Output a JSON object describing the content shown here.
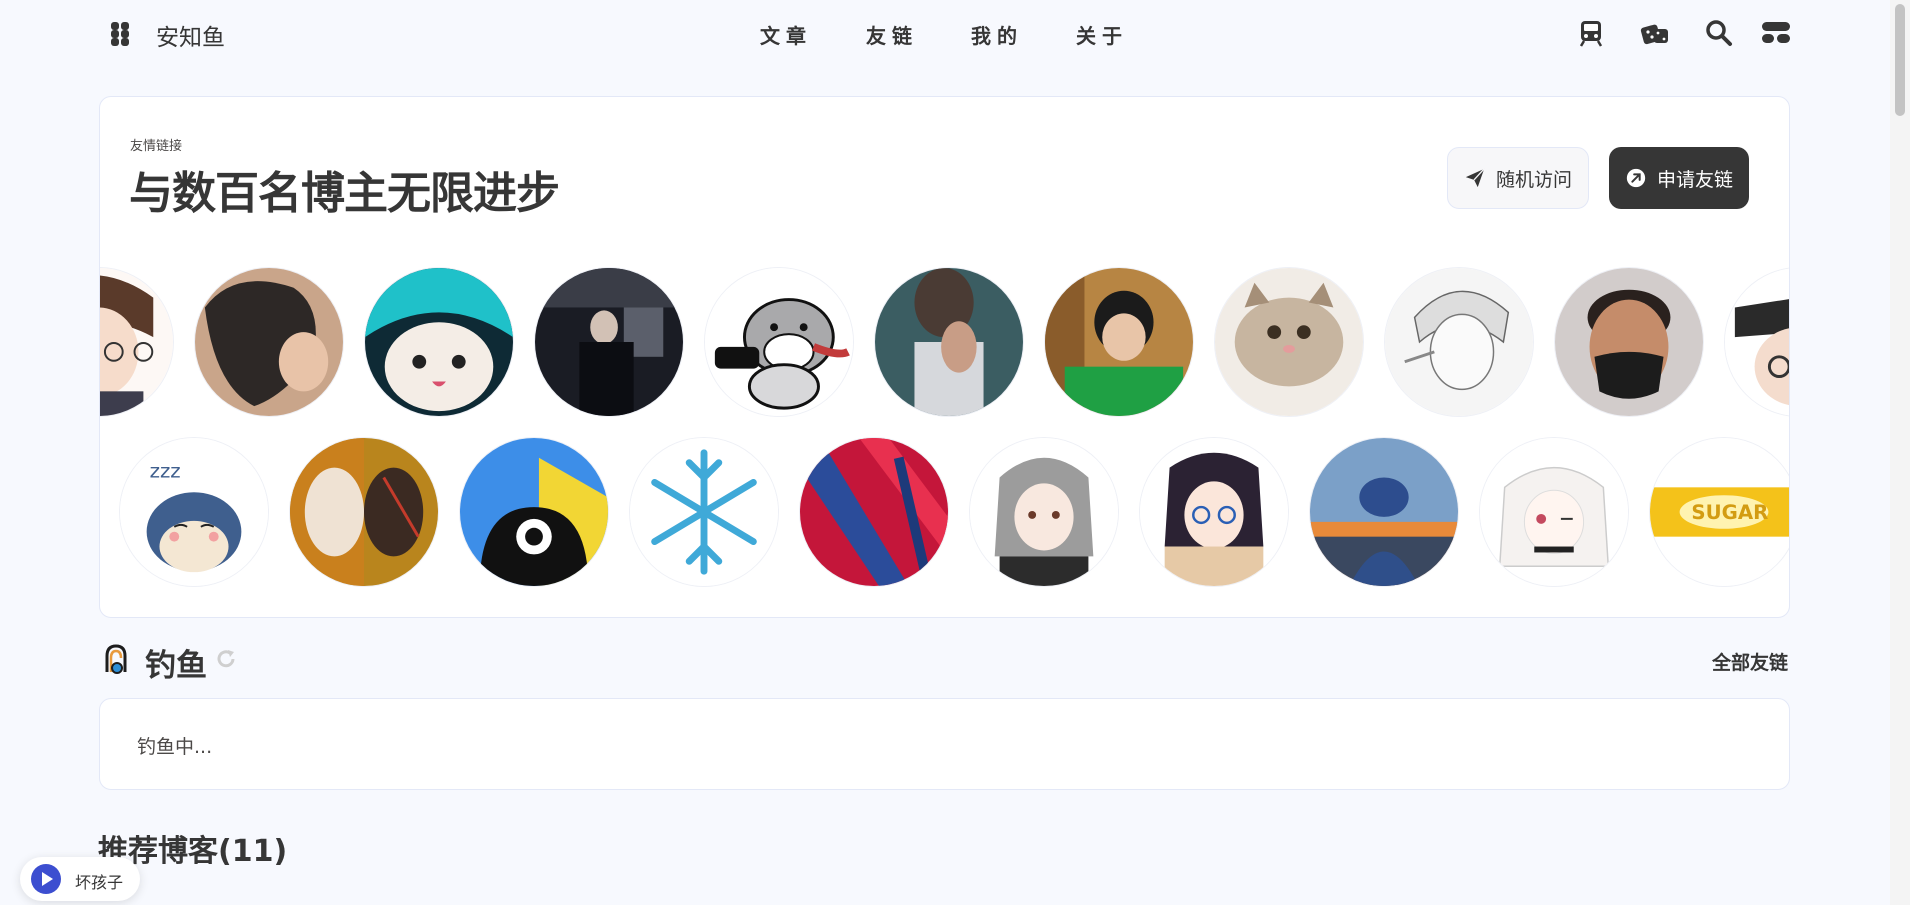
{
  "header": {
    "site_title": "安知鱼",
    "nav": [
      "文章",
      "友链",
      "我的",
      "关于"
    ],
    "right_icons": [
      "train-icon",
      "dice-icon",
      "search-icon",
      "console-icon"
    ]
  },
  "hero": {
    "tip": "友情链接",
    "title": "与数百名博主无限进步",
    "random_button": "随机访问",
    "apply_button": "申请友链"
  },
  "fishing": {
    "title": "钓鱼",
    "all_links": "全部友链",
    "status": "钓鱼中..."
  },
  "recommend": {
    "title": "推荐博客(11)"
  },
  "player": {
    "song": "坏孩子"
  },
  "colors": {
    "text": "#363636",
    "background": "#f7f9fe",
    "card": "#ffffff",
    "accent": "#3c4ed0"
  }
}
